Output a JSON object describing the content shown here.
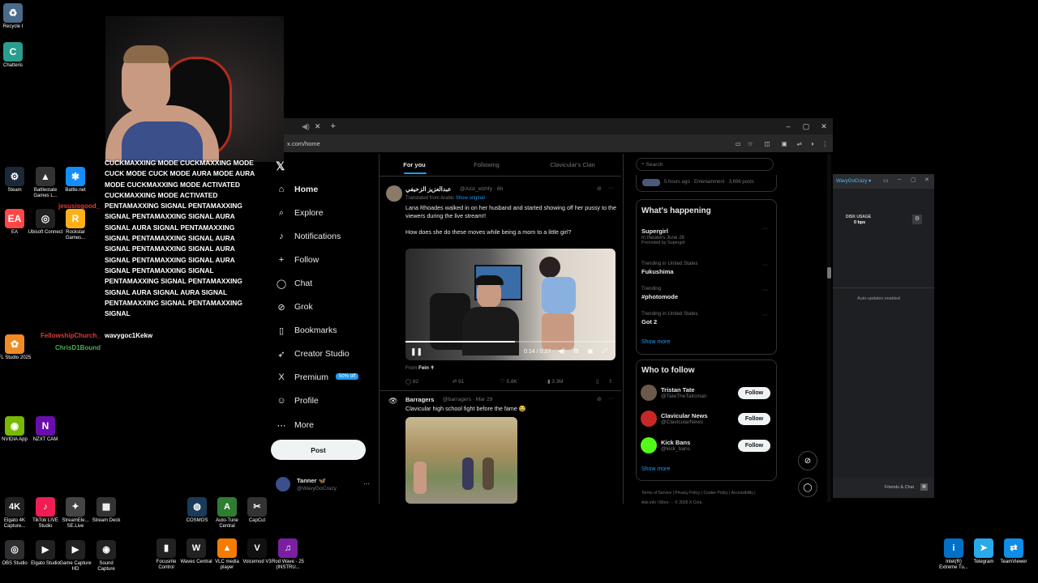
{
  "desktop_icons_left": [
    {
      "label": "Recycle I",
      "icon": "recycle-icon",
      "color": "#4a6b8a",
      "glyph": "♻"
    },
    {
      "label": "Chatteris",
      "icon": "chatterino-icon",
      "color": "#2a9d8f",
      "glyph": "C"
    },
    {
      "label": "Steam",
      "icon": "steam-icon",
      "color": "#1b2838",
      "glyph": "⚙"
    },
    {
      "label": "Battlestate Games L...",
      "icon": "battlestate-icon",
      "color": "#333",
      "glyph": "▲"
    },
    {
      "label": "Battle.net",
      "icon": "battlenet-icon",
      "color": "#148eff",
      "glyph": "✱"
    },
    {
      "label": "EA",
      "icon": "ea-icon",
      "color": "#ff4747",
      "glyph": "EA"
    },
    {
      "label": "Ubisoft Connect",
      "icon": "ubisoft-icon",
      "color": "#222",
      "glyph": "◎"
    },
    {
      "label": "Rockstar Games...",
      "icon": "rockstar-icon",
      "color": "#fcaf17",
      "glyph": "R"
    },
    {
      "label": "FL Studio 2025",
      "icon": "flstudio-icon",
      "color": "#f08a24",
      "glyph": "✿"
    },
    {
      "label": "NVIDIA App",
      "icon": "nvidia-icon",
      "color": "#76b900",
      "glyph": "◉"
    },
    {
      "label": "NZXT CAM",
      "icon": "nzxt-icon",
      "color": "#6a0dad",
      "glyph": "N"
    }
  ],
  "chat": {
    "message": "CUCKMAXXING MODE CUCKMAXXING MODE CUCK MODE CUCK MODE AURA MODE AURA MODE CUCKMAXXING MODE ACTIVATED CUCKMAXXING MODE ACTIVATED PENTAMAXXING SIGNAL PENTAMAXXING SIGNAL PENTAMAXXING SIGNAL AURA SIGNAL AURA SIGNAL PENTAMAXXING SIGNAL PENTAMAXXING SIGNAL AURA SIGNAL PENTAMAXXING SIGNAL AURA SIGNAL PENTAMAXXING SIGNAL AURA SIGNAL PENTAMAXXING SIGNAL PENTAMAXXING SIGNAL PENTAMAXXING SIGNAL AURA SIGNAL AURA SIGNAL PENTAMAXXING SIGNAL PENTAMAXXING SIGNAL",
    "user1": "jesusisgood_",
    "user2": "FellowshipChurch_",
    "user2_msg": "wavygoc1Kekw",
    "user3": "ChrisD1Bound"
  },
  "browser": {
    "tab_close": "✕",
    "new_tab": "+",
    "url": "x.com/home",
    "win_min": "–",
    "win_max": "▢",
    "win_close": "✕"
  },
  "x": {
    "nav": [
      {
        "label": "Home",
        "icon": "home-icon",
        "glyph": "⌂"
      },
      {
        "label": "Explore",
        "icon": "search-icon",
        "glyph": "⌕"
      },
      {
        "label": "Notifications",
        "icon": "bell-icon",
        "glyph": "♪"
      },
      {
        "label": "Follow",
        "icon": "add-user-icon",
        "glyph": "+"
      },
      {
        "label": "Chat",
        "icon": "chat-icon",
        "glyph": "◯"
      },
      {
        "label": "Grok",
        "icon": "grok-icon",
        "glyph": "⊘"
      },
      {
        "label": "Bookmarks",
        "icon": "bookmark-icon",
        "glyph": "▯"
      },
      {
        "label": "Creator Studio",
        "icon": "rocket-icon",
        "glyph": "➶"
      },
      {
        "label": "Premium",
        "icon": "x-logo-icon",
        "glyph": "X"
      },
      {
        "label": "Profile",
        "icon": "person-icon",
        "glyph": "☺"
      },
      {
        "label": "More",
        "icon": "more-icon",
        "glyph": "⋯"
      }
    ],
    "premium_badge": "50% off",
    "post_button": "Post",
    "account": {
      "name": "Tanner 🦋",
      "handle": "@WavyGoCrazy",
      "more": "···"
    },
    "tabs": [
      "For you",
      "Following",
      "Clavicular's Clan"
    ],
    "post1": {
      "name": "عبدالعزيز الزحيفي",
      "handle": "@Aziz_elzhfy · 8h",
      "translated": "Translated from Arabic",
      "show_original": "Show original",
      "text1": "Lana Rhoades walked in on her husband and started showing off her pussy to the viewers during the live stream!!",
      "text2": "How does she do these moves while being a mom to a little girl?",
      "video_time": "0:14 / 0:27",
      "video_progress": 0.52,
      "from_label": "From",
      "from_name": "Fein ✝",
      "replies": "82",
      "reposts": "91",
      "likes": "5.8K",
      "views": "3.3M"
    },
    "post2": {
      "name": "Barragers",
      "handle": "@barragers · Mar 29",
      "text": "Clavicular high school fight before the fame 😂"
    },
    "search_placeholder": "Search",
    "top_meta": "5 hours ago · Entertainment · 3,696 posts",
    "whats_happening": "What's happening",
    "trends": [
      {
        "meta": "",
        "name": "Supergirl",
        "sub": "In theaters June 26",
        "sub2": "Promoted by Supergirl"
      },
      {
        "meta": "Trending in United States",
        "name": "Fukushima"
      },
      {
        "meta": "Trending",
        "name": "#photomode"
      },
      {
        "meta": "Trending in United States",
        "name": "Got 2"
      }
    ],
    "show_more": "Show more",
    "who_to_follow": "Who to follow",
    "follow_suggestions": [
      {
        "name": "Tristan Tate",
        "handle": "@TateTheTalisman",
        "avatar": "#6b5a4a"
      },
      {
        "name": "Clavicular News",
        "handle": "@ClavicularNews",
        "avatar": "#c62828"
      },
      {
        "name": "Kick Bans",
        "handle": "@kick_bans",
        "avatar": "#53fc18"
      }
    ],
    "follow_label": "Follow",
    "footer": "Terms of Service  |  Privacy Policy  |  Cookie Policy  |  Accessibility  |  Ads info  |  More ···  © 2026 X Corp."
  },
  "side_window": {
    "account": "WavyGoCrazy ▾",
    "disk_label": "DISK USAGE",
    "disk_value": "0 bps",
    "auto_updates": "Auto-updates enabled",
    "friends_chat": "Friends & Chat"
  },
  "taskbar_left": [
    {
      "label": "Elgato 4K Capture...",
      "color": "#222",
      "glyph": "4K"
    },
    {
      "label": "TikTok LIVE Studio",
      "color": "#ee1d52",
      "glyph": "♪"
    },
    {
      "label": "StreamEle... SE.Live",
      "color": "#444",
      "glyph": "✦"
    },
    {
      "label": "Stream Deck",
      "color": "#333",
      "glyph": "▦"
    },
    {
      "label": "OBS Studio",
      "color": "#302e31",
      "glyph": "◎"
    },
    {
      "label": "Elgato Studio",
      "color": "#222",
      "glyph": "▶"
    },
    {
      "label": "Game Capture HD",
      "color": "#222",
      "glyph": "▶"
    },
    {
      "label": "Sound Capture",
      "color": "#222",
      "glyph": "◉"
    }
  ],
  "taskbar_mid": [
    {
      "label": "COSMOS",
      "color": "#1a3a5a",
      "glyph": "◍"
    },
    {
      "label": "Auto-Tune Central",
      "color": "#2e7d32",
      "glyph": "A"
    },
    {
      "label": "CapCut",
      "color": "#333",
      "glyph": "✂"
    },
    {
      "label": "Focusrite Control",
      "color": "#222",
      "glyph": "▮"
    },
    {
      "label": "Waves Central",
      "color": "#222",
      "glyph": "W"
    },
    {
      "label": "VLC media player",
      "color": "#f57c00",
      "glyph": "▲"
    },
    {
      "label": "Voicemod V3",
      "color": "#111",
      "glyph": "V"
    },
    {
      "label": "Rod Wave - 25 (INSTRU...",
      "color": "#7b1fa2",
      "glyph": "♫"
    }
  ],
  "taskbar_right": [
    {
      "label": "Intel(R) Extreme Tu...",
      "color": "#0071c5",
      "glyph": "i"
    },
    {
      "label": "Telegram",
      "color": "#29a9ea",
      "glyph": "➤"
    },
    {
      "label": "TeamViewer",
      "color": "#0e8ee9",
      "glyph": "⇄"
    }
  ]
}
